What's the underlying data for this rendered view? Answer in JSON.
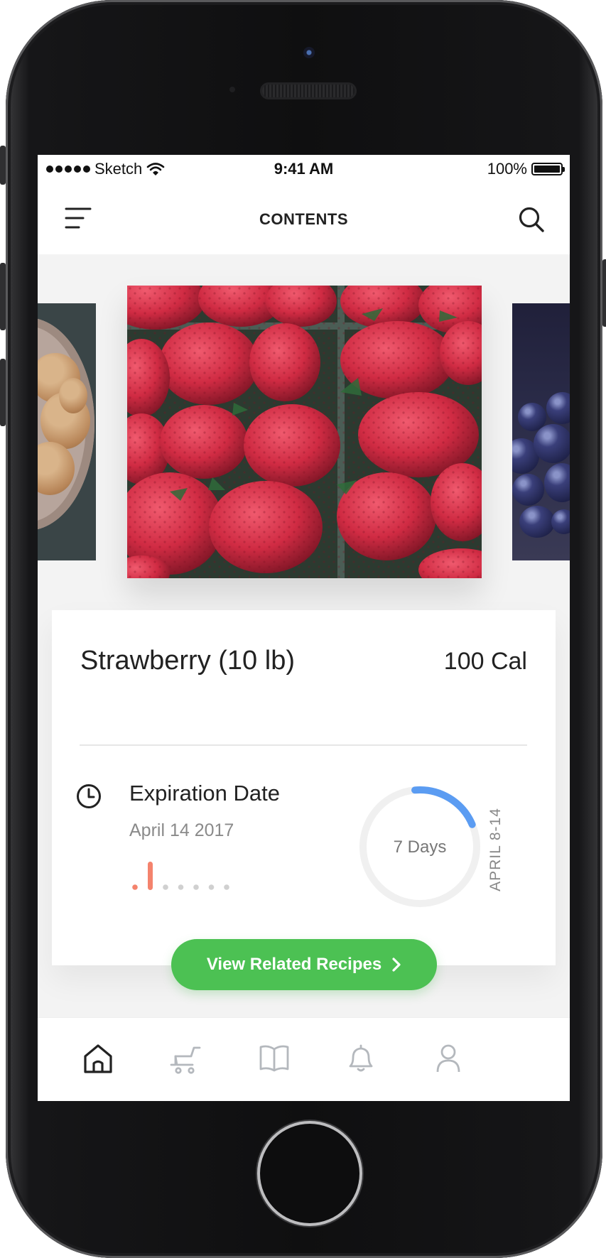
{
  "status_bar": {
    "carrier": "Sketch",
    "time": "9:41 AM",
    "battery": "100%"
  },
  "header": {
    "title": "CONTENTS",
    "menu_icon": "hamburger-menu-icon",
    "search_icon": "search-icon"
  },
  "carousel": {
    "items": [
      {
        "name": "cookies",
        "state": "previous"
      },
      {
        "name": "strawberries",
        "state": "active"
      },
      {
        "name": "blueberries",
        "state": "next"
      }
    ]
  },
  "item": {
    "name": "Strawberry (10 lb)",
    "calories": "100 Cal",
    "expiration": {
      "label": "Expiration Date",
      "date": "April 14 2017",
      "days_left": "7 Days",
      "range": "APRIL 8-14",
      "progress_fraction": 0.2,
      "week_marks": 7,
      "current_mark": 1
    }
  },
  "cta": {
    "label": "View Related Recipes",
    "icon": "chevron-right-icon"
  },
  "tab_bar": {
    "tabs": [
      {
        "name": "home",
        "icon": "home-icon",
        "active": true
      },
      {
        "name": "cart",
        "icon": "cart-icon",
        "active": false
      },
      {
        "name": "recipes",
        "icon": "book-icon",
        "active": false
      },
      {
        "name": "notifications",
        "icon": "bell-icon",
        "active": false
      },
      {
        "name": "profile",
        "icon": "user-icon",
        "active": false
      }
    ]
  },
  "colors": {
    "accent_green": "#4cc153",
    "ring_blue": "#5b9cf2",
    "ring_track": "#f0f0f0",
    "mark_coral": "#f4836d",
    "mark_gray": "#d0d0d0"
  }
}
